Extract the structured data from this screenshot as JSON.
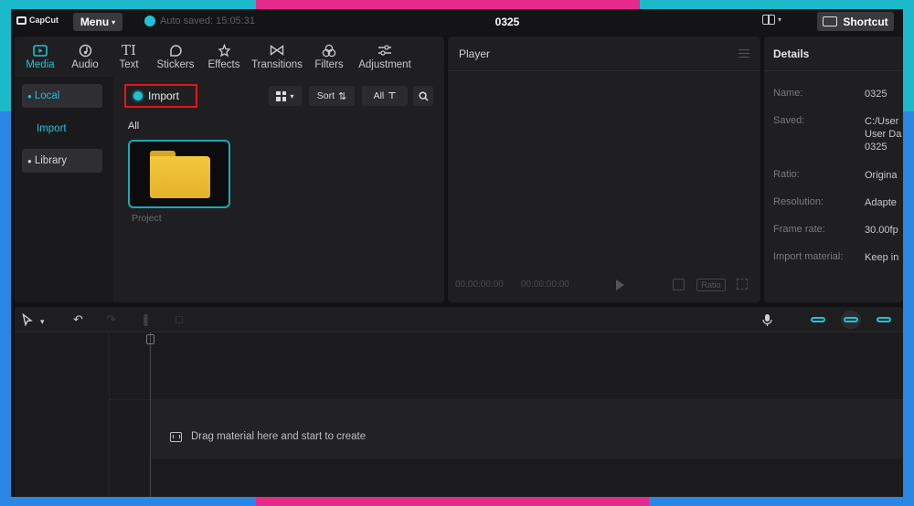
{
  "app": {
    "logo_text": "CapCut",
    "menu_label": "Menu",
    "autosave_text": "Auto saved: 15:05:31",
    "project_title": "0325",
    "shortcut_label": "Shortcut"
  },
  "media": {
    "tabs": [
      {
        "label": "Media",
        "icon": "media-icon",
        "active": true
      },
      {
        "label": "Audio",
        "icon": "audio-icon"
      },
      {
        "label": "Text",
        "icon": "text-icon"
      },
      {
        "label": "Stickers",
        "icon": "stickers-icon"
      },
      {
        "label": "Effects",
        "icon": "effects-icon"
      },
      {
        "label": "Transitions",
        "icon": "transitions-icon"
      },
      {
        "label": "Filters",
        "icon": "filters-icon"
      },
      {
        "label": "Adjustment",
        "icon": "adjustment-icon"
      }
    ],
    "sidebar": {
      "local": "Local",
      "import": "Import",
      "library": "Library"
    },
    "toolbar": {
      "import_label": "Import",
      "sort_label": "Sort",
      "all_label": "All"
    },
    "section_label": "All",
    "thumbnail_label": "Project",
    "highlight_color": "#e0161e",
    "accent_color": "#22c2d4"
  },
  "player": {
    "title": "Player",
    "time_current": "00:00:00:00",
    "time_total": "00:00:00:00",
    "ratio_label": "Ratio"
  },
  "details": {
    "title": "Details",
    "rows": [
      {
        "key": "Name:",
        "value": "0325"
      },
      {
        "key": "Saved:",
        "value": "C:/User\nUser Da\n0325"
      },
      {
        "key": "Ratio:",
        "value": "Origina"
      },
      {
        "key": "Resolution:",
        "value": "Adapte"
      },
      {
        "key": "Frame rate:",
        "value": "30.00fp"
      },
      {
        "key": "Import material:",
        "value": "Keep in"
      }
    ]
  },
  "timeline": {
    "drag_hint": "Drag material here and start to create"
  }
}
